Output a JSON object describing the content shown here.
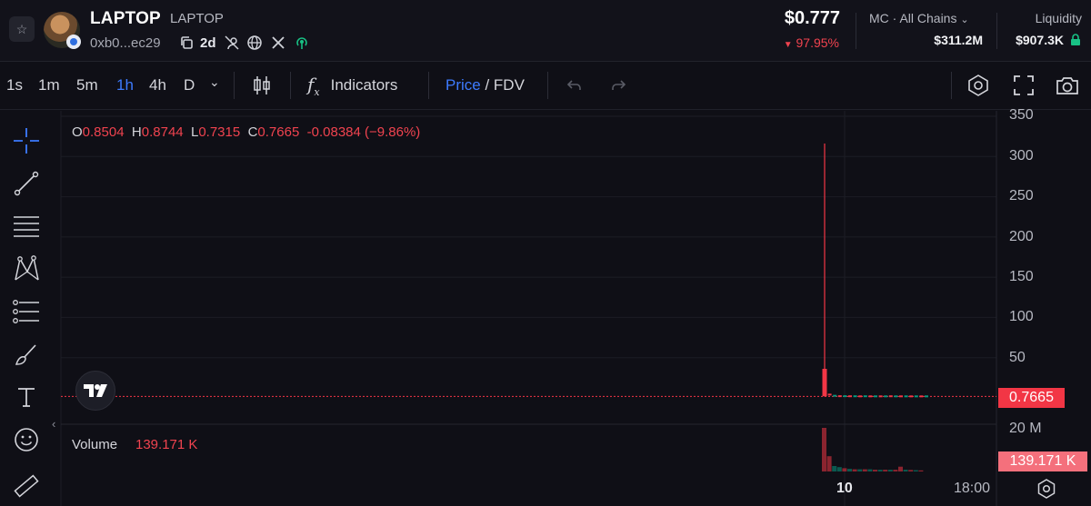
{
  "token": {
    "name": "LAPTOP",
    "symbol": "LAPTOP",
    "address": "0xb0...ec29",
    "age": "2d"
  },
  "stats": {
    "price": "$0.777",
    "change": "97.95%",
    "mc_label": "MC · All Chains",
    "mc_value": "$311.2M",
    "liquidity_label": "Liquidity",
    "liquidity_value": "$907.3K"
  },
  "toolbar": {
    "timeframes": [
      "1s",
      "1m",
      "5m",
      "1h",
      "4h",
      "D"
    ],
    "active_timeframe": "1h",
    "indicators_label": "Indicators",
    "price_label": "Price",
    "fdv_label": "FDV"
  },
  "ohlc": {
    "o_key": "O",
    "o": "0.8504",
    "h_key": "H",
    "h": "0.8744",
    "l_key": "L",
    "l": "0.7315",
    "c_key": "C",
    "c": "0.7665",
    "change": "-0.08384 (−9.86%)"
  },
  "volume": {
    "label": "Volume",
    "value": "139.171 K",
    "tag": "139.171 K",
    "axis_label": "20 M"
  },
  "chart_data": {
    "type": "candlestick",
    "y_ticks": [
      "350",
      "300",
      "250",
      "200",
      "150",
      "100",
      "50"
    ],
    "ylim": [
      0,
      350
    ],
    "x_ticks": [
      "10",
      "18:00"
    ],
    "current_price": "0.7665",
    "spike_high": 315,
    "spike_body_top": 35,
    "candles_after_spike": [
      3,
      1.5,
      1,
      1,
      0.9,
      0.9,
      0.8,
      0.9,
      0.8,
      0.8,
      0.8,
      0.8,
      0.9,
      0.8,
      0.8,
      0.8,
      0.77,
      0.77,
      0.77,
      0.77
    ],
    "volume_bars": [
      20,
      7,
      2.5,
      2,
      1.5,
      1.2,
      1,
      1,
      1,
      1,
      0.8,
      0.8,
      0.8,
      0.8,
      0.8,
      2.2,
      0.8,
      0.7,
      0.6,
      0.5
    ],
    "volume_colors": [
      "down",
      "down",
      "up",
      "up",
      "down",
      "up",
      "down",
      "up",
      "down",
      "up",
      "down",
      "up",
      "down",
      "up",
      "down",
      "down",
      "up",
      "down",
      "up",
      "down"
    ]
  },
  "colors": {
    "down": "#f23645",
    "up": "#089981",
    "accent": "#3d7bff"
  }
}
